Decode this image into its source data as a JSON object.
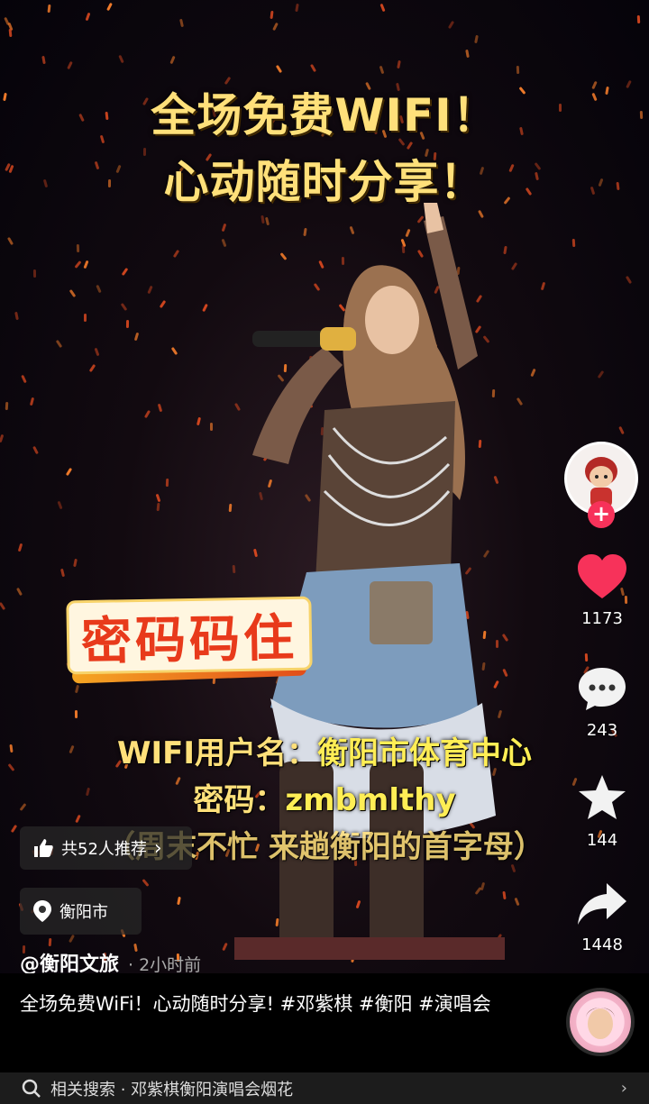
{
  "overlay": {
    "title_line1": "全场免费WIFI！",
    "title_line2": "心动随时分享！",
    "password_badge": "密码码住",
    "wifi_user_label": "WIFI用户名：",
    "wifi_user_value": "衡阳市体育中心",
    "wifi_pwd_label": "密码：",
    "wifi_pwd_value": "zmbmlthy",
    "wifi_hint": "（周末不忙 来趟衡阳的首字母）"
  },
  "actions": {
    "like_count": "1173",
    "comment_count": "243",
    "favorite_count": "144",
    "share_count": "1448",
    "follow_symbol": "+"
  },
  "pills": {
    "recommend": "共52人推荐",
    "recommend_arrow": "›",
    "location": "衡阳市"
  },
  "author": {
    "name": "@衡阳文旅",
    "time": "· 2小时前"
  },
  "caption": "全场免费WiFi！心动随时分享! #邓紫棋 #衡阳 #演唱会",
  "related": {
    "text": "相关搜索 · 邓紫棋衡阳演唱会烟花",
    "arrow": "›"
  },
  "icons": {
    "like": "heart-icon",
    "comment": "comment-icon",
    "favorite": "star-icon",
    "share": "share-icon",
    "thumb": "thumb-up-icon",
    "location": "location-pin-icon",
    "search": "search-icon"
  },
  "colors": {
    "like": "#f7325a",
    "title_text": "#ffe07a",
    "badge_text": "#e83a1b"
  }
}
